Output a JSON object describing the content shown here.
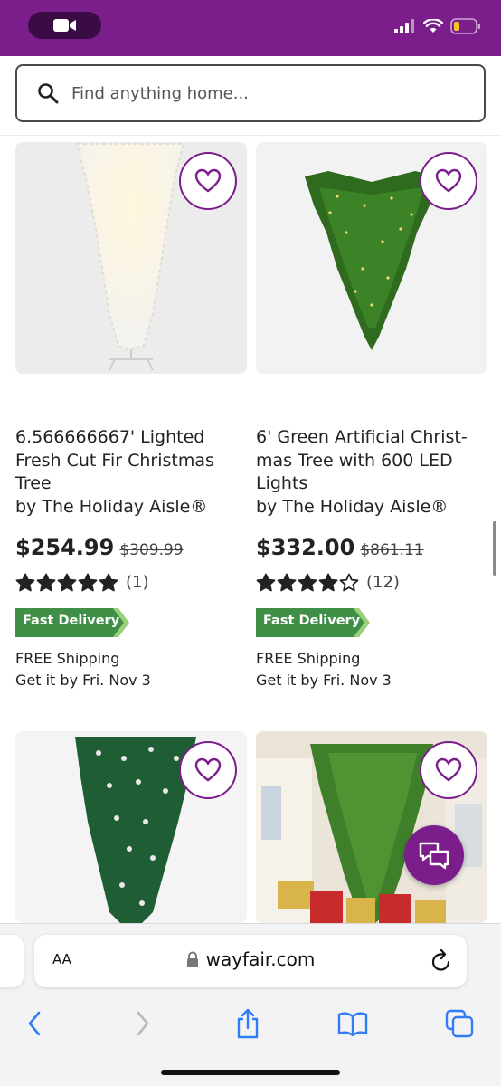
{
  "search": {
    "placeholder": "Find anything home..."
  },
  "products": [
    {
      "title": "6.566666667' Lighted Fresh Cut Fir Christmas Tree",
      "brand": "by The Holiday Aisle®",
      "price": "$254.99",
      "was_price": "$309.99",
      "rating": 5,
      "review_count": "(1)",
      "badge": "Fast Delivery",
      "shipping": "FREE Shipping",
      "eta": "Get it by Fri. Nov 3"
    },
    {
      "title": "6' Green Artificial Christ-mas Tree with 600 LED Lights",
      "brand": "by The Holiday Aisle®",
      "price": "$332.00",
      "was_price": "$861.11",
      "rating": 4,
      "review_count": "(12)",
      "badge": "Fast Delivery",
      "shipping": "FREE Shipping",
      "eta": "Get it by Fri. Nov 3"
    }
  ],
  "browser": {
    "text_size_label": "AA",
    "url": "wayfair.com"
  },
  "colors": {
    "brand_purple": "#7b1e8c",
    "badge_green": "#3f8f47",
    "star": "#222222"
  },
  "icons": {
    "status": [
      "video-camera-icon",
      "cellular-signal-icon",
      "wifi-icon",
      "battery-low-icon"
    ],
    "search": "magnifier-icon",
    "favorite": "heart-outline-icon",
    "chat": "chat-bubbles-icon",
    "browser": [
      "lock-icon",
      "reload-icon",
      "back-icon",
      "forward-icon",
      "share-icon",
      "bookmarks-icon",
      "tabs-icon"
    ]
  }
}
